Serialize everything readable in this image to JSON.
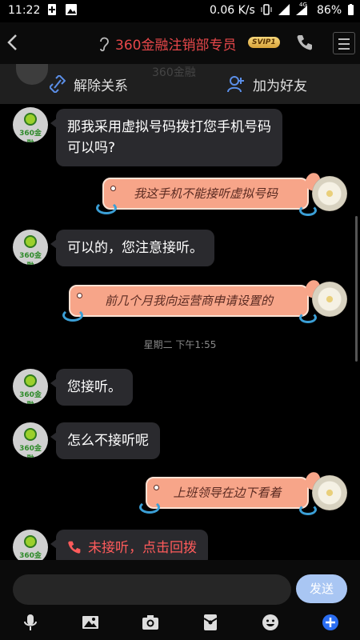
{
  "status_bar": {
    "time": "11:22",
    "network_speed": "0.06 K/s",
    "battery": "86%",
    "signal_label": "4G"
  },
  "header": {
    "title": "360金融注销部专员",
    "badge": "SVIP1"
  },
  "actions": {
    "unlink_label": "解除关系",
    "add_friend_label": "加为好友"
  },
  "background_hint": {
    "name_text": "360金融"
  },
  "messages": [
    {
      "side": "left",
      "text_line1": "那我采用虚拟号码拨打您手机号码",
      "text_line2": "可以吗?"
    },
    {
      "side": "right",
      "style": "fish",
      "text": "我这手机不能接听虚拟号码"
    },
    {
      "side": "left",
      "text": "可以的，您注意接听。"
    },
    {
      "side": "right",
      "style": "fish",
      "text": "前几个月我向运营商申请设置的"
    },
    {
      "type": "timestamp",
      "text": "星期二 下午1:55"
    },
    {
      "side": "left",
      "text": "您接听。"
    },
    {
      "side": "left",
      "text": "怎么不接听呢"
    },
    {
      "side": "right",
      "style": "fish",
      "text": "上班领导在边下看着"
    },
    {
      "side": "left",
      "type": "missed_call",
      "text": "未接听，点击回拨"
    }
  ],
  "avatar_text": "360金融",
  "input": {
    "placeholder": "",
    "send_label": "发送"
  },
  "toolbar": {
    "icons": [
      "microphone-icon",
      "image-icon",
      "camera-icon",
      "red-packet-icon",
      "emoji-icon",
      "plus-icon"
    ]
  },
  "colors": {
    "title": "#e7474a",
    "bubble": "#2a2a2e",
    "fish_bubble": "#f7a589",
    "send_button": "#a9c6f3",
    "missed_call": "#ff5b5b"
  }
}
